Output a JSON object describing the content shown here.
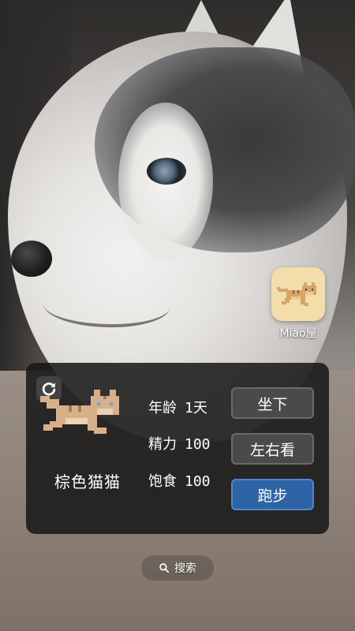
{
  "app": {
    "name": "Miao屋",
    "icon": "pixel-cat-icon",
    "icon_bg": "#f3deab"
  },
  "widget": {
    "refresh_icon": "refresh-icon",
    "cat_sprite": "pixel-cat-running",
    "cat_name": "棕色猫猫",
    "stats": {
      "age": {
        "label": "年龄",
        "value": "1天"
      },
      "energy": {
        "label": "精力",
        "value": "100"
      },
      "food": {
        "label": "饱食",
        "value": "100"
      }
    },
    "buttons": {
      "sit": "坐下",
      "look": "左右看",
      "run": "跑步"
    },
    "active_button_color": "#2e63a6"
  },
  "search": {
    "label": "搜索",
    "icon": "search-icon"
  }
}
